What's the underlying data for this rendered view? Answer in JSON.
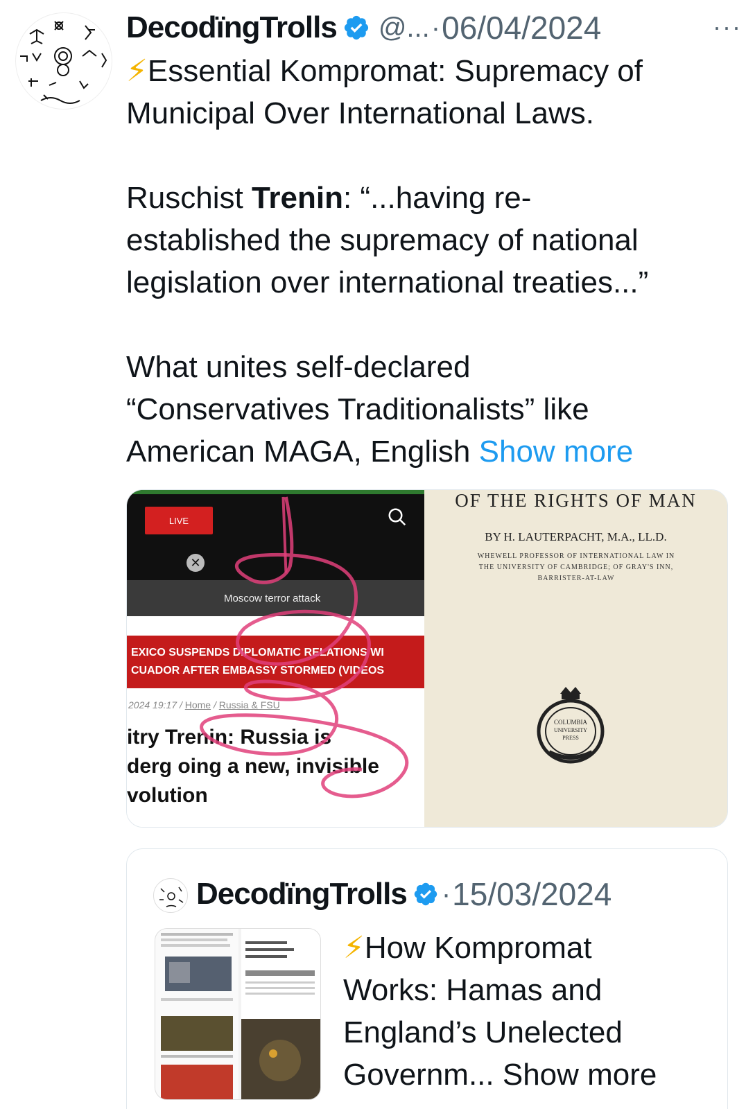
{
  "tweet": {
    "display_name": "DecodïngTrolls",
    "handle": "@...",
    "separator": "·",
    "date": "06/04/2024",
    "more_label": "···",
    "lines": [
      "⚡",
      "Essential Kompromat: Supremacy of",
      "Municipal Over International Laws.",
      "Ruschist ",
      "Trenin",
      ": “...having re-",
      "established the supremacy of national",
      "legislation over international treaties...”",
      "What unites self-declared",
      "“Conservatives Traditionalists” like",
      "American MAGA, English "
    ],
    "show_more": "Show more"
  },
  "media_left": {
    "live_label": "LIVE",
    "bar_label": "Moscow terror attack",
    "red_line1": "EXICO SUSPENDS DIPLOMATIC RELATIONS WI",
    "red_line2": "CUADOR AFTER EMBASSY STORMED (VIDEOS",
    "meta_time": "2024 19:17 / ",
    "meta_home": "Home",
    "meta_sep": " / ",
    "meta_section": "Russia & FSU",
    "headline1": "itry Trenin: Russia is",
    "headline2": "derg oing a new, invisible",
    "headline3": "volution",
    "close_label": "✕"
  },
  "media_right": {
    "title": "OF THE RIGHTS OF MAN",
    "author": "BY H. LAUTERPACHT, M.A., LL.D.",
    "sub1": "WHEWELL PROFESSOR OF INTERNATIONAL LAW IN",
    "sub2": "THE UNIVERSITY OF CAMBRIDGE; OF GRAY'S INN,",
    "sub3": "BARRISTER-AT-LAW",
    "seal_line1": "COLUMBIA",
    "seal_line2": "UNIVERSITY",
    "seal_line3": "PRESS"
  },
  "quote": {
    "display_name": "DecodïngTrolls",
    "separator": "·",
    "date": "15/03/2024",
    "lines": [
      "⚡",
      "How Kompromat",
      "Works: Hamas and",
      "England’s Unelected",
      "Governm... "
    ],
    "show_more": "Show more"
  },
  "colors": {
    "link": "#1d9bf0",
    "secondary_text": "#536471",
    "verified": "#1d9bf0",
    "bolt": "#f4b400",
    "scribble": "#e0407a"
  },
  "icons": [
    "verified-badge-icon",
    "more-options-icon",
    "search-icon",
    "close-icon",
    "lightning-icon"
  ]
}
